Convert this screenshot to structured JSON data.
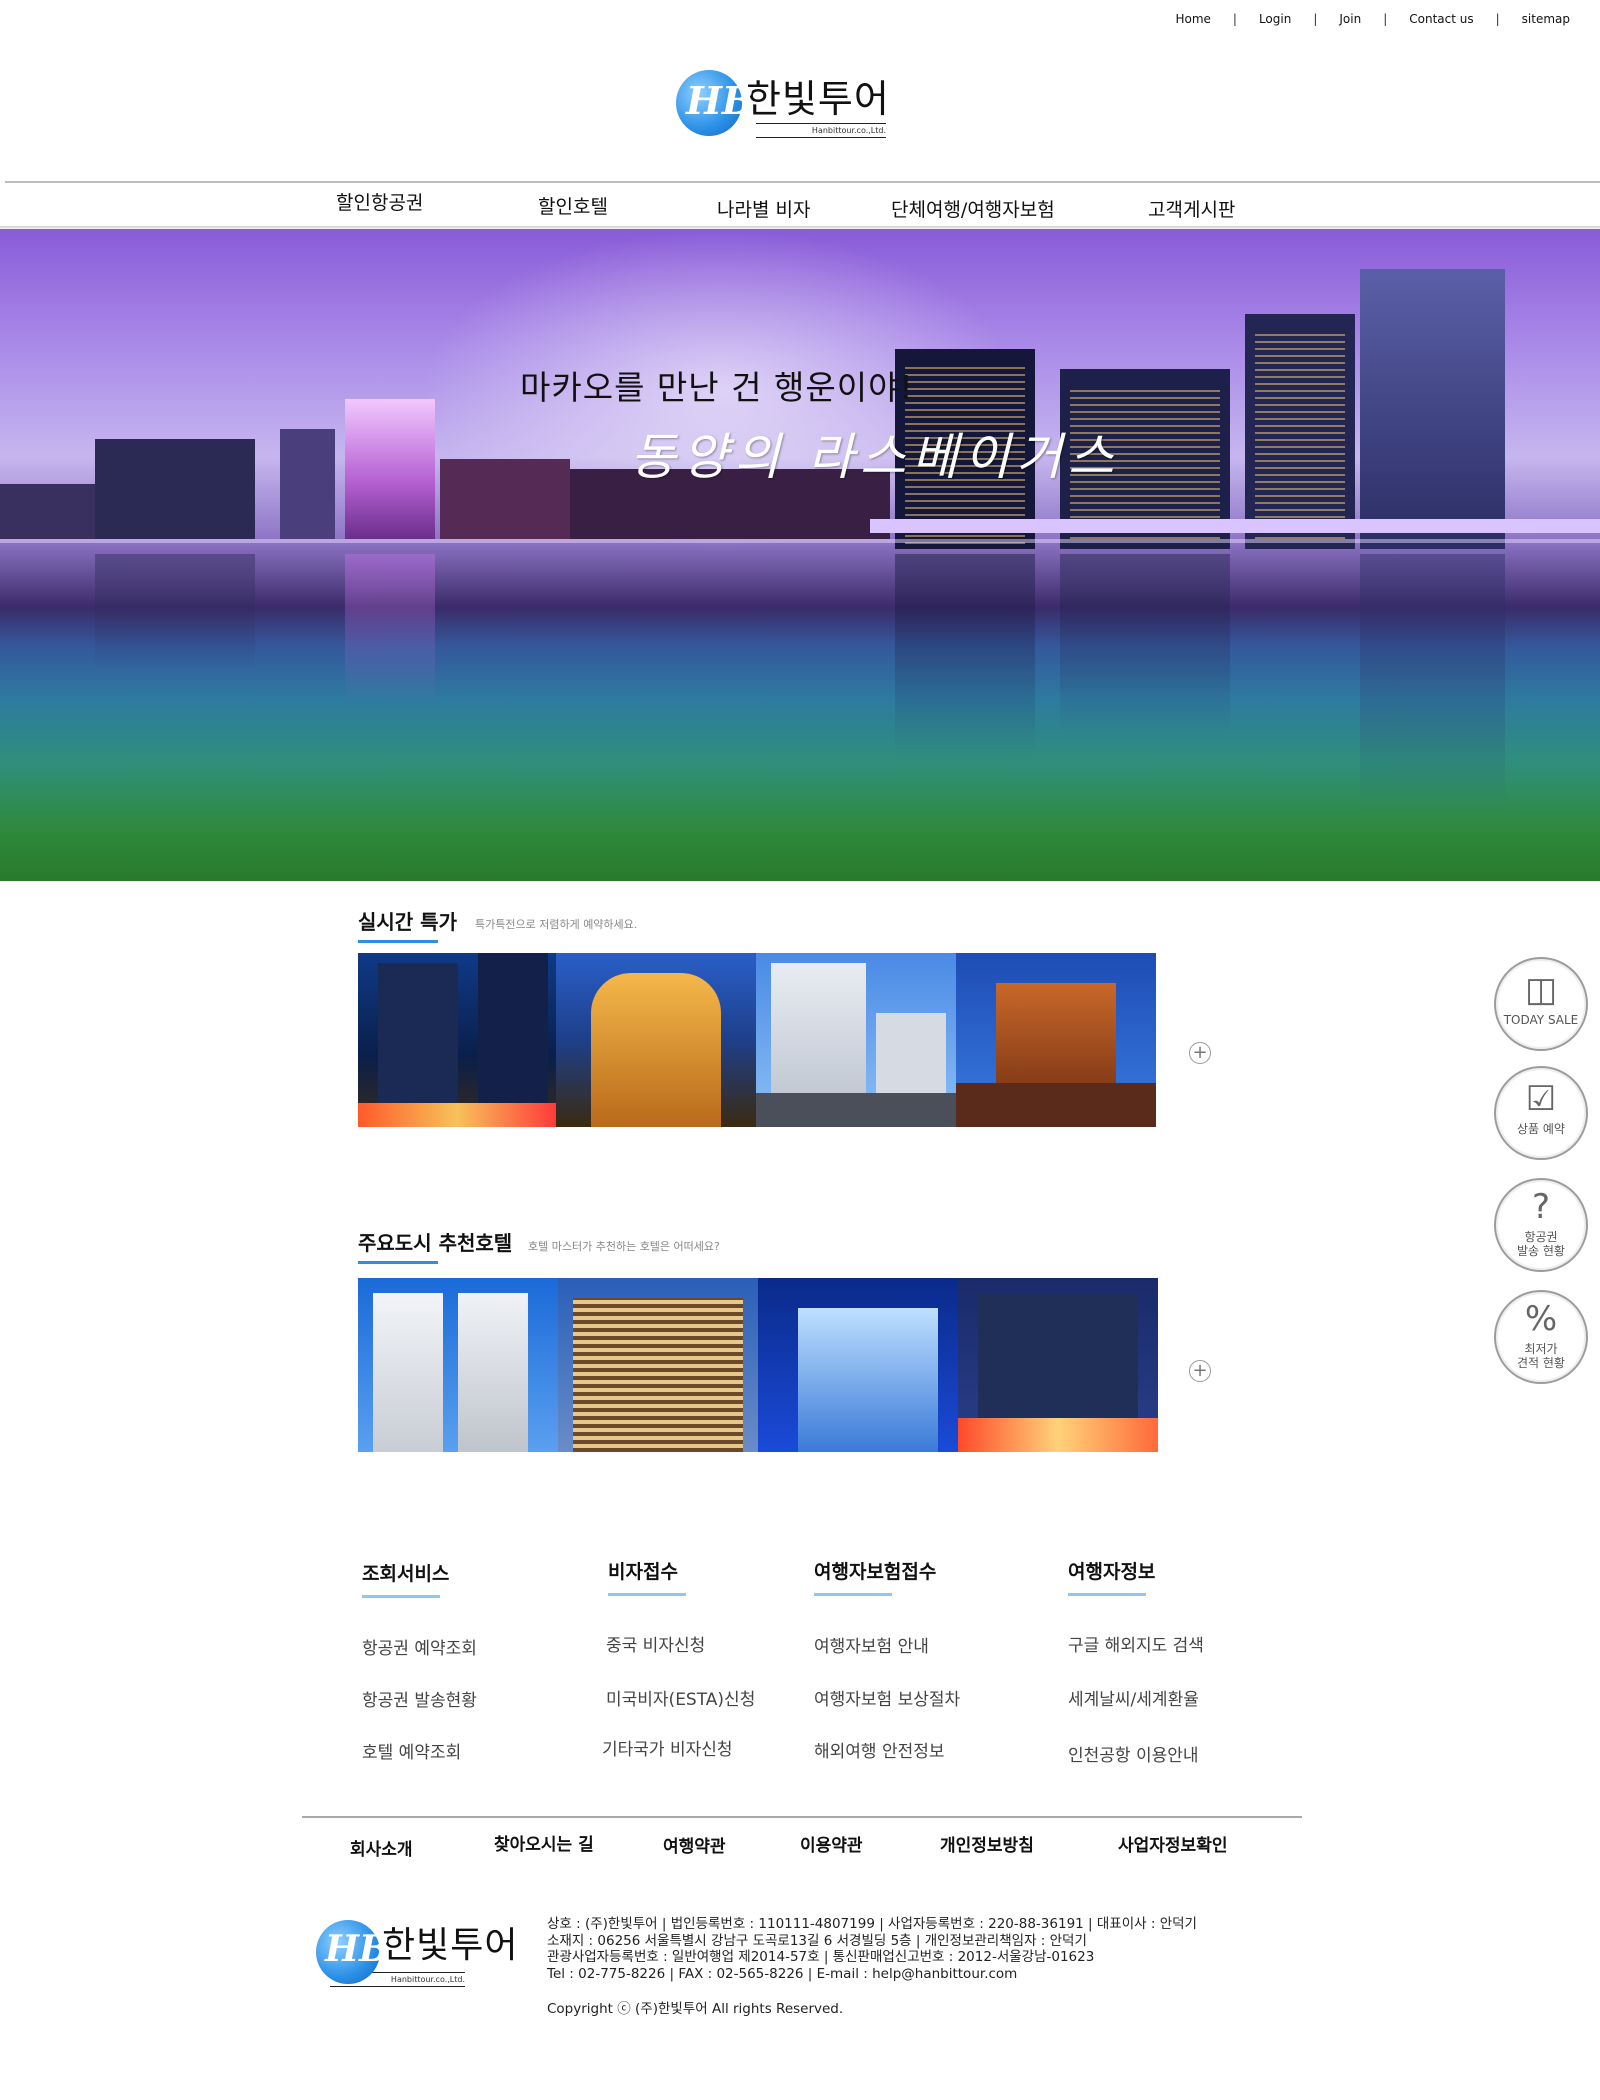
{
  "top_links": [
    "Home",
    "Login",
    "Join",
    "Contact us",
    "sitemap"
  ],
  "top_link_separator": "|",
  "brand": {
    "name": "한빛투어",
    "sub": "Hanbittour.co.,Ltd.",
    "mark": "HB",
    "accent": "#2a8fe6"
  },
  "nav": [
    "할인항공권",
    "할인호텔",
    "나라별 비자",
    "단체여행/여행자보험",
    "고객게시판"
  ],
  "hero": {
    "line1": "마카오를 만난 건 행운이야!",
    "line2": "동양의 라스베이거스"
  },
  "sections": {
    "deals": {
      "title": "실시간 특가",
      "sub": "특가특전으로 저렴하게 예약하세요."
    },
    "hotels": {
      "title": "주요도시 추천호텔",
      "sub": "호텔 마스터가 추천하는 호텔은 어떠세요?"
    }
  },
  "more_icon": "plus-circle-icon",
  "quick_menu": [
    {
      "icon": "gift-icon",
      "label1": "TODAY SALE",
      "label2": ""
    },
    {
      "icon": "clipboard-check-icon",
      "label1": "상품 예약",
      "label2": ""
    },
    {
      "icon": "question-icon",
      "label1": "항공권",
      "label2": "발송 현황"
    },
    {
      "icon": "percent-bag-icon",
      "label1": "최저가",
      "label2": "견적 현황"
    }
  ],
  "link_columns": [
    {
      "title": "조회서비스",
      "links": [
        "항공권 예약조회",
        "항공권 발송현황",
        "호텔 예약조회"
      ]
    },
    {
      "title": "비자접수",
      "links": [
        "중국 비자신청",
        "미국비자(ESTA)신청",
        "기타국가 비자신청"
      ]
    },
    {
      "title": "여행자보험접수",
      "links": [
        "여행자보험 안내",
        "여행자보험 보상절차",
        "해외여행 안전정보"
      ]
    },
    {
      "title": "여행자정보",
      "links": [
        "구글 해외지도 검색",
        "세계날씨/세계환율",
        "인천공항 이용안내"
      ]
    }
  ],
  "bottom_nav": [
    "회사소개",
    "찾아오시는 길",
    "여행약관",
    "이용약관",
    "개인정보방침",
    "사업자정보확인"
  ],
  "company_info": [
    "상호 : (주)한빛투어 | 법인등록번호 : 110111-4807199 | 사업자등록번호 : 220-88-36191 | 대표이사 : 안덕기",
    "소재지 : 06256 서울특별시 강남구 도곡로13길 6 서경빌딩 5층 | 개인정보관리책임자 : 안덕기",
    "관광사업자등록번호 : 일반여행업 제2014-57호 | 통신판매업신고번호 : 2012-서울강남-01623",
    "Tel : 02-775-8226 | FAX : 02-565-8226 | E-mail : help@hanbittour.com"
  ],
  "copyright": "Copyright ⓒ (주)한빛투어 All rights Reserved."
}
